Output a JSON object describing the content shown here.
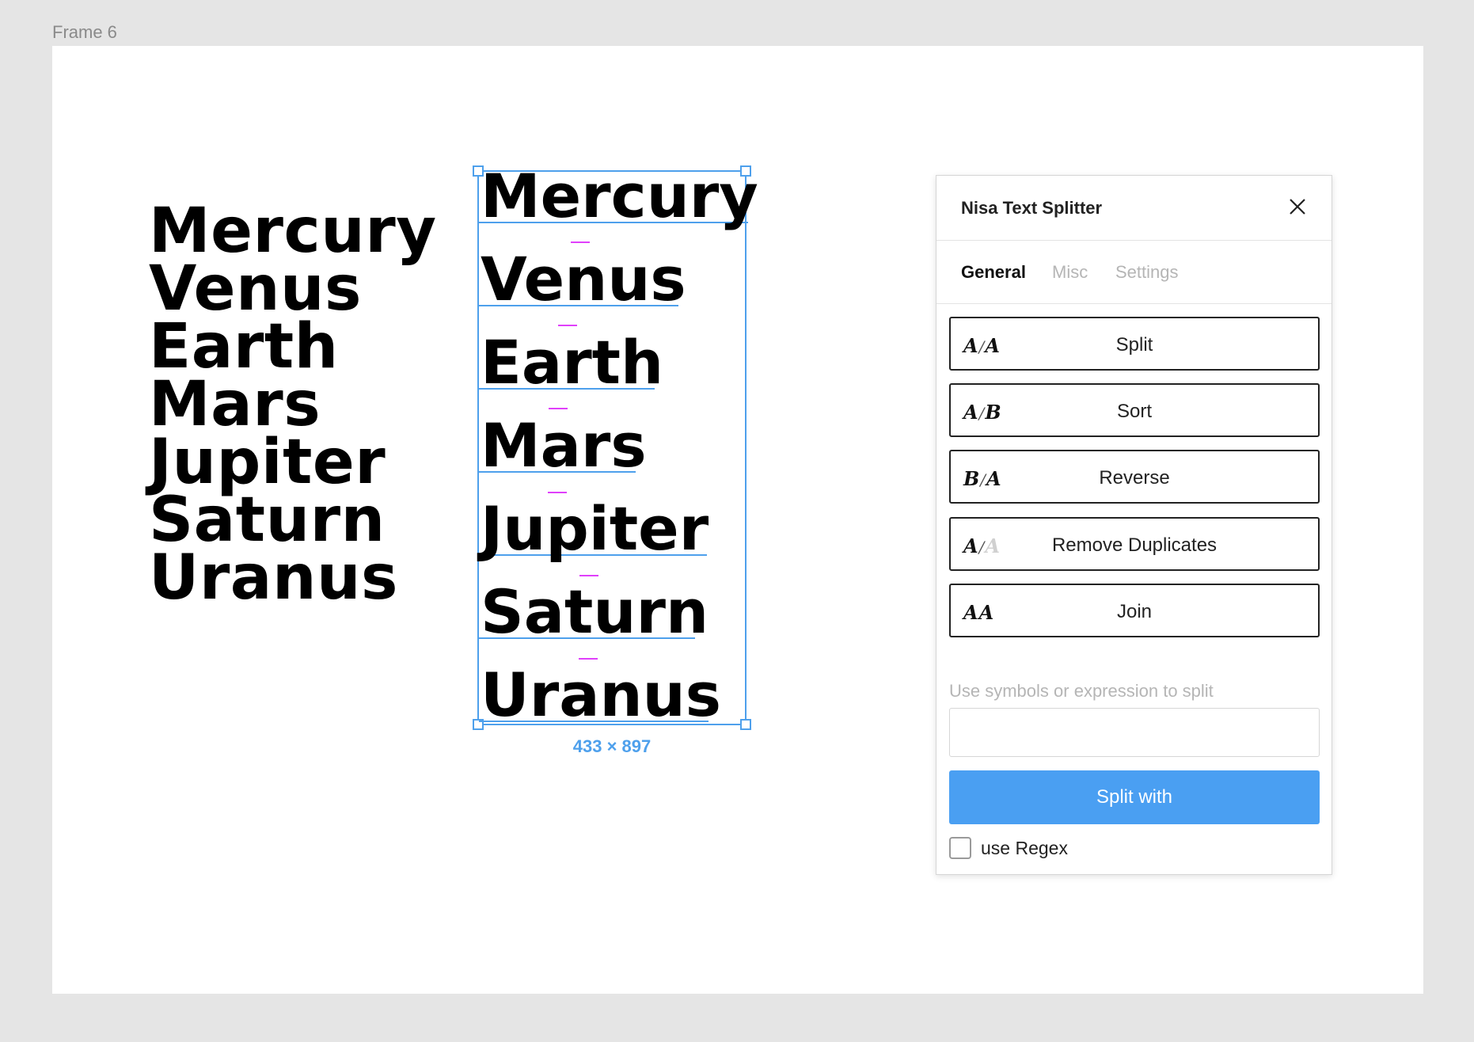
{
  "frame": {
    "label": "Frame 6"
  },
  "original_text": {
    "lines": [
      "Mercury",
      "Venus",
      "Earth",
      "Mars",
      "Jupiter",
      "Saturn",
      "Uranus"
    ]
  },
  "split_text": {
    "items": [
      "Mercury",
      "Venus",
      "Earth",
      "Mars",
      "Jupiter",
      "Saturn",
      "Uranus"
    ],
    "dimensions": "433 × 897"
  },
  "panel": {
    "title": "Nisa Text Splitter",
    "close_icon": "close-icon",
    "tabs": [
      {
        "label": "General",
        "active": true
      },
      {
        "label": "Misc",
        "active": false
      },
      {
        "label": "Settings",
        "active": false
      }
    ],
    "actions": [
      {
        "label": "Split",
        "icon": "split-icon"
      },
      {
        "label": "Sort",
        "icon": "sort-icon"
      },
      {
        "label": "Reverse",
        "icon": "reverse-icon"
      },
      {
        "label": "Remove Duplicates",
        "icon": "remove-duplicates-icon"
      },
      {
        "label": "Join",
        "icon": "join-icon"
      }
    ],
    "split_hint": "Use symbols or expression to split",
    "split_input_value": "",
    "split_with_label": "Split with",
    "regex": {
      "label": "use Regex",
      "checked": false
    }
  },
  "colors": {
    "selection": "#4ea0ec",
    "spacer": "#e040fb",
    "primary_button": "#4a9ff2"
  }
}
